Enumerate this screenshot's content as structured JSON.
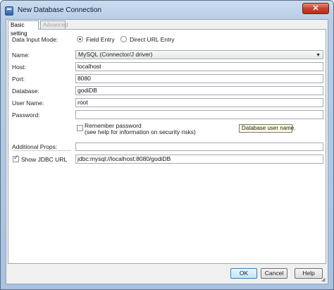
{
  "window": {
    "title": "New Database Connection",
    "close_symbol": "✕"
  },
  "tabs": [
    {
      "label": "Basic setting",
      "active": true
    },
    {
      "label": "Advanced",
      "active": false
    }
  ],
  "form": {
    "data_input_mode_label": "Data Input Mode:",
    "mode_options": [
      {
        "label": "Field Entry",
        "selected": true
      },
      {
        "label": "Direct URL Entry",
        "selected": false
      }
    ],
    "name_label": "Name:",
    "name_value": "MySQL (Connector/J driver)",
    "host_label": "Host:",
    "host_value": "localhost",
    "port_label": "Port:",
    "port_value": "8080",
    "database_label": "Database:",
    "database_value": "godiDB",
    "username_label": "User Name:",
    "username_value": "root",
    "password_label": "Password:",
    "password_value": "",
    "remember_label_line1": "Remember password",
    "remember_label_line2": "(see help for information on security risks)",
    "remember_checked": false,
    "additional_props_label": "Additional Props:",
    "additional_props_value": "",
    "show_jdbc_label": "Show JDBC URL",
    "show_jdbc_checked": true,
    "jdbc_url_value": "jdbc:mysql://localhost:8080/godiDB"
  },
  "tooltip": {
    "text": "Database user name."
  },
  "buttons": {
    "ok": "OK",
    "cancel": "Cancel",
    "help": "Help"
  },
  "colors": {
    "title_gradient": "#b7cde6",
    "close_red": "#c7412b",
    "panel_bg": "#ffffff",
    "dialog_bg": "#f0f0f0",
    "tooltip_bg": "#ffffe1"
  }
}
